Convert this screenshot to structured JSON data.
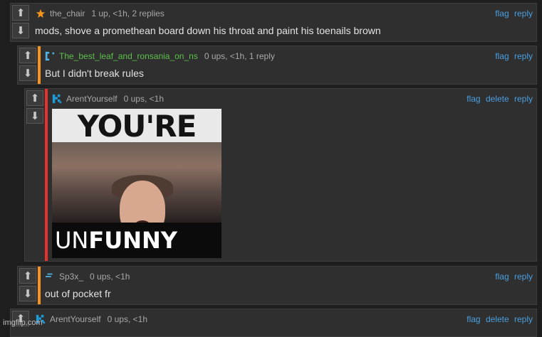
{
  "colors": {
    "page_bg": "#1e1e1e",
    "comment_bg": "#2f2f2f",
    "link": "#4a9fe0",
    "meta_text": "#a8a8a8",
    "body_text": "#e2e2e2",
    "bar_orange": "#f7941d",
    "bar_red": "#e5322d"
  },
  "vote": {
    "up_icon": "arrow-up-icon",
    "down_icon": "arrow-down-icon",
    "up_glyph": "⬆",
    "down_glyph": "⬇"
  },
  "actions": {
    "flag": "flag",
    "delete": "delete",
    "reply": "reply"
  },
  "comments": [
    {
      "username": "the_chair",
      "meta": "1 up, <1h, 2 replies",
      "text": "mods, shove a promethean board down his throat and paint his toenails brown",
      "icon": "star-icon",
      "name_color": "#a8a8a8"
    },
    {
      "username": "The_best_leaf_and_ronsania_on_ns",
      "meta": "0 ups, <1h, 1 reply",
      "text": "But I didn't break rules",
      "icon": "bracket-icon",
      "name_color": "#5cc04a"
    },
    {
      "username": "ArentYourself",
      "meta": "0 ups, <1h",
      "icon": "pixel-k-icon",
      "name_color": "#a8a8a8",
      "meme": {
        "top_text": "YOU'RE",
        "bottom_text_light": "UN",
        "bottom_text_bold": "FUNNY"
      }
    },
    {
      "username": "Sp3x_",
      "meta": "0 ups, <1h",
      "text": "out of pocket fr",
      "icon": "dash-icon",
      "name_color": "#a8a8a8"
    },
    {
      "username": "ArentYourself",
      "meta": "0 ups, <1h",
      "icon": "pixel-k-icon",
      "name_color": "#a8a8a8"
    }
  ],
  "watermark": "imgflip.com"
}
